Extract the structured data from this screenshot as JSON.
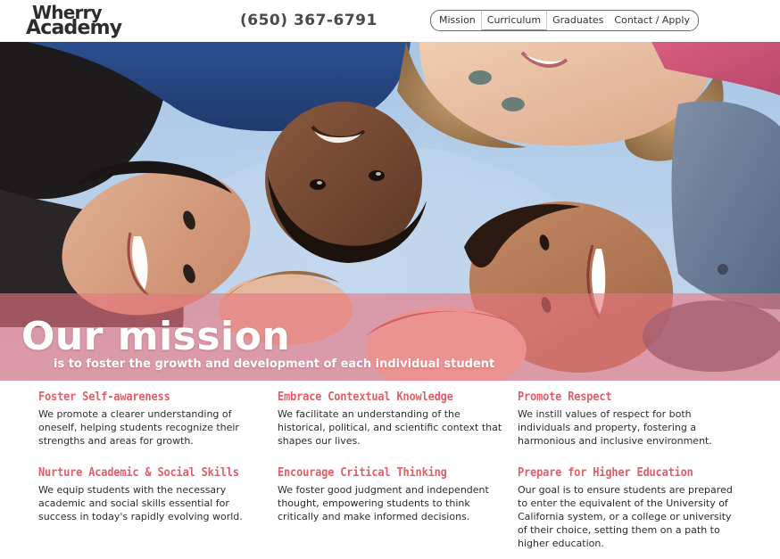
{
  "header": {
    "logo": {
      "line1": "Wherry",
      "line2": "Academy"
    },
    "phone": "(650) 367-6791",
    "nav": [
      {
        "label": "Mission",
        "active": false
      },
      {
        "label": "Curriculum",
        "active": true
      },
      {
        "label": "Graduates",
        "active": false
      },
      {
        "label": "Contact / Apply",
        "active": false
      }
    ]
  },
  "hero": {
    "title": "Our mission",
    "subtitle": "is to foster the growth and development of each individual student"
  },
  "features": [
    {
      "title": "Foster Self-awareness",
      "body": "We promote a clearer understanding of oneself, helping students recognize their strengths and areas for growth."
    },
    {
      "title": "Embrace Contextual Knowledge",
      "body": "We facilitate an understanding of the historical, political, and scientific context that shapes our lives."
    },
    {
      "title": "Promote Respect",
      "body": "We instill values of respect for both individuals and property, fostering a harmonious and inclusive environment."
    },
    {
      "title": "Nurture Academic & Social Skills",
      "body": "We equip students with the necessary academic and social skills essential for success in today's rapidly evolving world."
    },
    {
      "title": "Encourage Critical Thinking",
      "body": "We foster good judgment and independent thought, empowering students to think critically and make informed decisions."
    },
    {
      "title": "Prepare for Higher Education",
      "body": "Our goal is to ensure students are prepared to enter the equivalent of the University of California system, or a college or university of their choice, setting them on a path to higher education."
    }
  ],
  "theme": {
    "accent": "#e35d68",
    "band": "#e7757f",
    "text": "#2b2b2b"
  }
}
